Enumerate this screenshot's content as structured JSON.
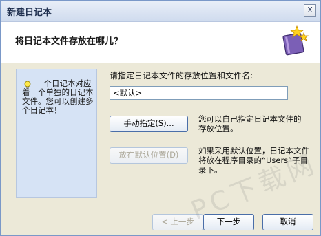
{
  "window": {
    "title": "新建日记本",
    "close_label": "X"
  },
  "header": {
    "question": "将日记本文件存放在哪儿？"
  },
  "hint": {
    "text": "一个日记本对应着一个单独的日记本文件。您可以创建多个日记本！"
  },
  "form": {
    "path_label": "请指定日记本文件的存放位置和文件名:",
    "path_value": "<默认>"
  },
  "manual": {
    "button_label": "手动指定(S)...",
    "description": "您可以自己指定日记本文件的存放位置。"
  },
  "default": {
    "button_label": "放在默认位置(D)",
    "description": "如果采用默认位置，日记本文件将放在程序目录的“Users”子目录下。"
  },
  "footer": {
    "back_label": "< 上一步",
    "next_label": "下一步",
    "cancel_label": "取消"
  },
  "watermark": {
    "text": "PC下载网"
  }
}
